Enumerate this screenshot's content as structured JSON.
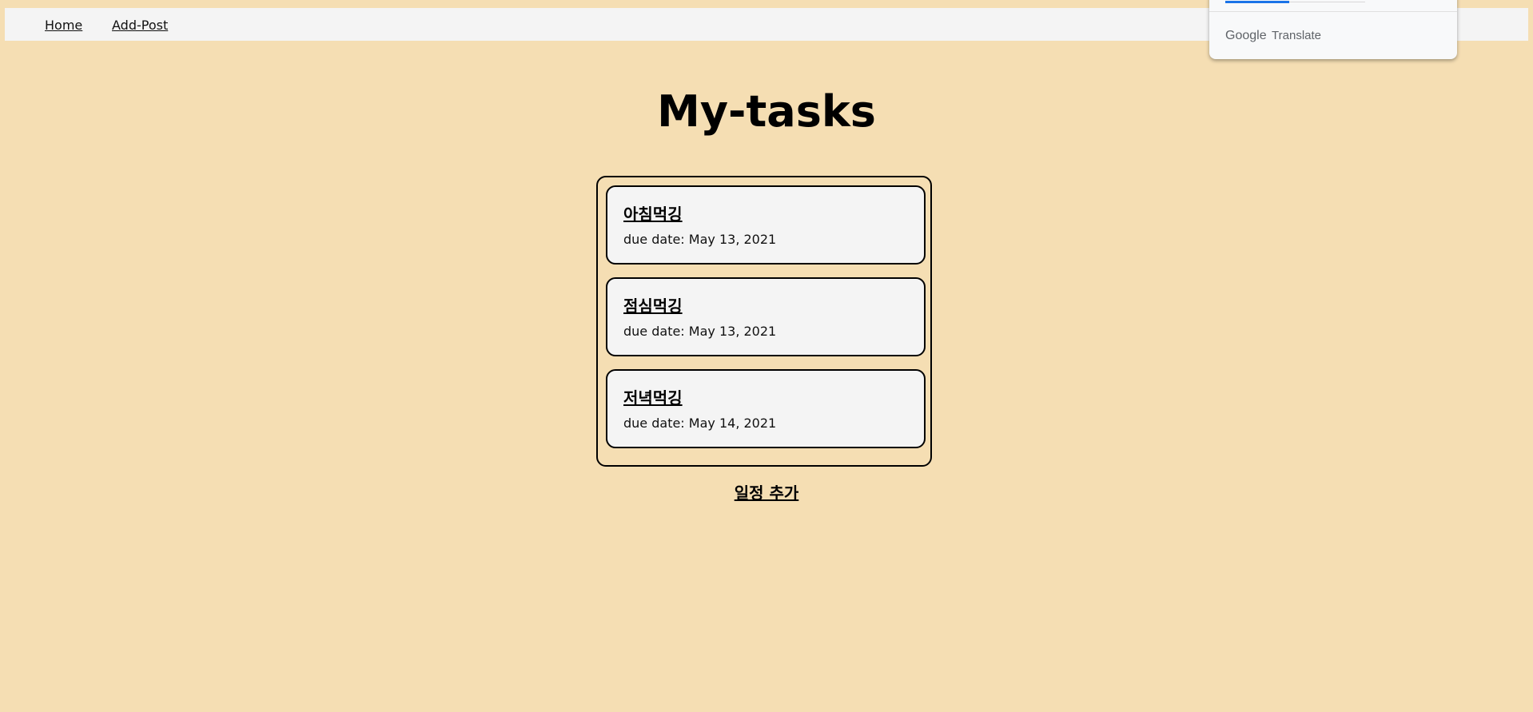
{
  "nav": {
    "home_label": "Home",
    "add_post_label": "Add-Post"
  },
  "page": {
    "title": "My-tasks"
  },
  "tasks": [
    {
      "title": "아침먹깅",
      "due_label": "due date:",
      "due_value": "May 13, 2021"
    },
    {
      "title": "점심먹깅",
      "due_label": "due date:",
      "due_value": "May 13, 2021"
    },
    {
      "title": "저녁먹깅",
      "due_label": "due date:",
      "due_value": "May 14, 2021"
    }
  ],
  "actions": {
    "add_schedule_label": "일정 추가"
  },
  "translate_popup": {
    "brand_google": "Google",
    "brand_translate": "Translate"
  },
  "colors": {
    "background": "#f5deb3",
    "navbar": "#f4f4f4",
    "card": "#f4f4f4",
    "accent": "#1a73e8"
  }
}
